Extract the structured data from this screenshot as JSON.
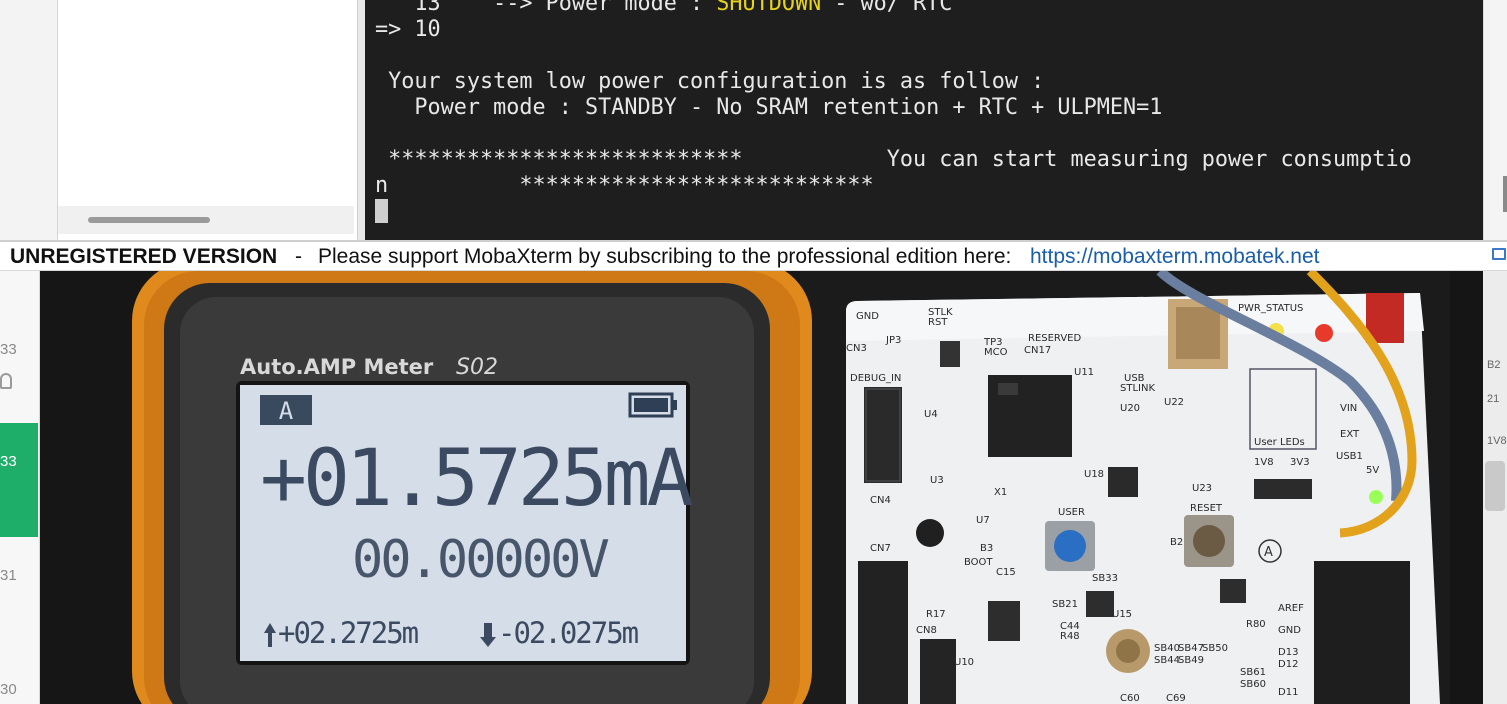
{
  "terminal": {
    "lines": [
      {
        "before": "   13    --> Power mode : ",
        "highlight": "SHUTDOWN",
        "after": " - wo/ RTC"
      },
      {
        "text": "=> 10"
      },
      {
        "text": " Your system low power configuration is as follow :"
      },
      {
        "text": "   Power mode : STANDBY - No SRAM retention + RTC + ULPMEN=1"
      },
      {
        "text": " ***************************           You can start measuring power consumptio"
      },
      {
        "text": "n          ***************************"
      }
    ],
    "highlight_color": "#e6d31a"
  },
  "banner": {
    "title": "UNREGISTERED VERSION",
    "separator": "-",
    "message": "Please support MobaXterm by subscribing to the professional edition here:",
    "link": "https://mobaxterm.mobatek.net"
  },
  "sidebar_numbers": [
    "33",
    "33",
    "31",
    "30"
  ],
  "right_numbers": [
    "B2",
    "21",
    "1V8"
  ],
  "meter": {
    "brand": "Auto.AMP Meter",
    "model": "S02",
    "mode_badge": "A",
    "main_reading": "+01.5725mA",
    "voltage_reading": "00.00000V",
    "max_reading": "+02.2725m",
    "min_reading": "-02.0275m"
  },
  "board": {
    "labels": [
      "GND",
      "STLK",
      "RST",
      "CN3",
      "JP3",
      "RESERVED",
      "TP3",
      "MCO",
      "CN17",
      "PWR_STATUS",
      "U11",
      "USB",
      "STLINK",
      "DEBUG_IN",
      "U4",
      "U20",
      "U22",
      "User LEDs",
      "VIN",
      "EXT",
      "USB1",
      "1V8",
      "3V3",
      "5V",
      "CN4",
      "U3",
      "U18",
      "X1",
      "U23",
      "U7",
      "BOOT",
      "USER",
      "RESET",
      "CN7",
      "C15",
      "U15",
      "SB21",
      "R17",
      "C44",
      "R48",
      "CN8",
      "U10",
      "C60",
      "C69",
      "SB33",
      "SB40",
      "SB44",
      "SB47",
      "SB49",
      "SB50",
      "R80",
      "GND",
      "D13",
      "D12",
      "D11",
      "SB61",
      "SB60",
      "AREF",
      "B2",
      "B3",
      "A"
    ],
    "led_colors": [
      "#f4e04a",
      "#e83a2a",
      "#9bff5a"
    ]
  },
  "colors": {
    "terminal_bg": "#1e1e1e",
    "accent_green": "#1fae6a",
    "link_blue": "#1a5ea8",
    "lcd_bg": "#d4dde8"
  }
}
